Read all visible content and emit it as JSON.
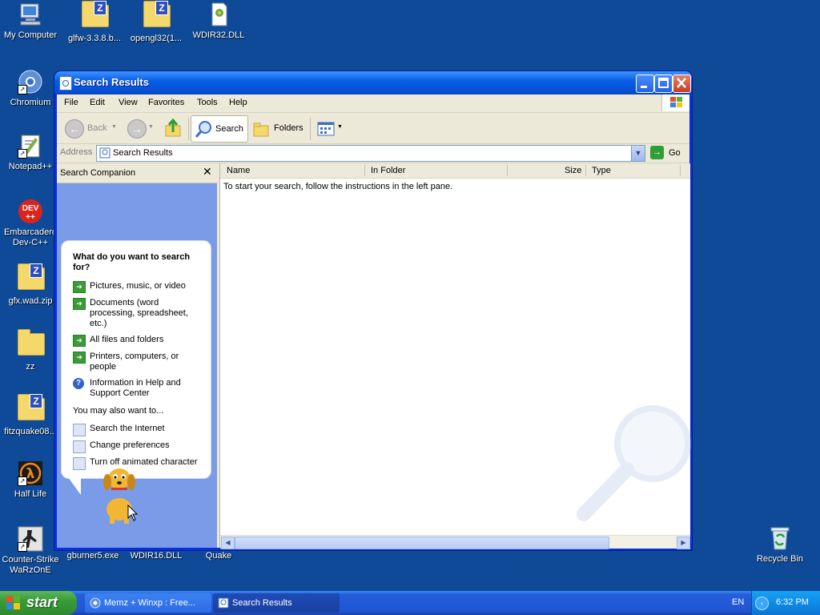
{
  "desktop": {
    "icons": [
      {
        "label": "My Computer"
      },
      {
        "label": "glfw-3.3.8.b..."
      },
      {
        "label": "opengl32(1..."
      },
      {
        "label": "WDIR32.DLL"
      },
      {
        "label": "Chromium"
      },
      {
        "label": "Notepad++"
      },
      {
        "label": "Embarcadero Dev-C++"
      },
      {
        "label": "gfx.wad.zip"
      },
      {
        "label": "zz"
      },
      {
        "label": "fitzquake08..."
      },
      {
        "label": "Half Life"
      },
      {
        "label": "Counter-Strike WaRzOnE"
      },
      {
        "label": "gburner5.exe"
      },
      {
        "label": "WDIR16.DLL"
      },
      {
        "label": "Quake"
      },
      {
        "label": "Recycle Bin"
      }
    ]
  },
  "window": {
    "title": "Search Results",
    "menu": [
      "File",
      "Edit",
      "View",
      "Favorites",
      "Tools",
      "Help"
    ],
    "toolbar": {
      "back": "Back",
      "search": "Search",
      "folders": "Folders"
    },
    "address": {
      "label": "Address",
      "value": "Search Results",
      "go": "Go"
    },
    "companion": {
      "title": "Search Companion",
      "question": "What do you want to search for?",
      "options": [
        "Pictures, music, or video",
        "Documents (word processing, spreadsheet, etc.)",
        "All files and folders",
        "Printers, computers, or people",
        "Information in Help and Support Center"
      ],
      "also_label": "You may also want to...",
      "also": [
        "Search the Internet",
        "Change preferences",
        "Turn off animated character"
      ]
    },
    "results": {
      "columns": [
        "Name",
        "In Folder",
        "Size",
        "Type"
      ],
      "hint": "To start your search, follow the instructions in the left pane."
    }
  },
  "taskbar": {
    "start": "start",
    "tasks": [
      "Memz + Winxp : Free...",
      "Search Results"
    ],
    "language": "EN",
    "clock": "6:32 PM"
  },
  "colors": {
    "desktop": "#0f4a98",
    "titlebar": "#0a5fe6",
    "companion": "#7a9be8",
    "start": "#3a9b38",
    "taskbar": "#245edb"
  }
}
